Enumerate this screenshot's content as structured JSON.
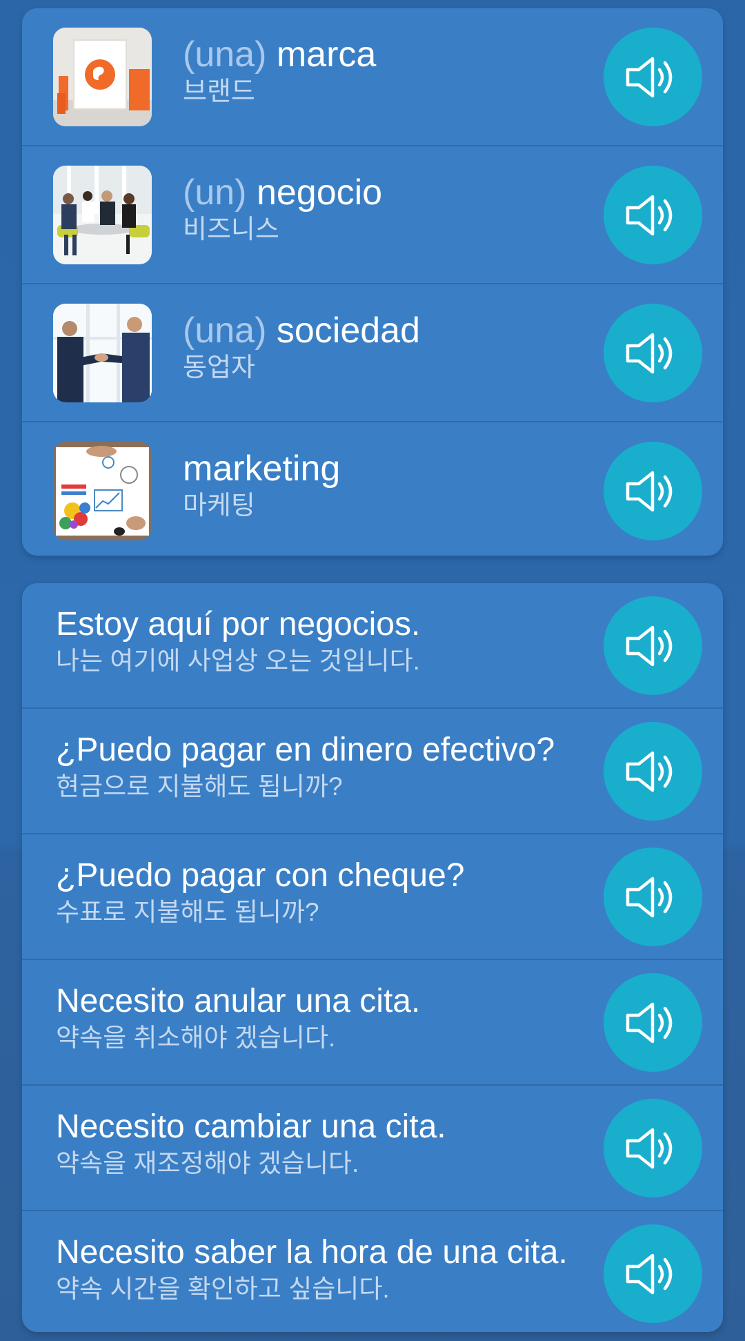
{
  "colors": {
    "background": "#2b67a8",
    "card": "#3a7fc6",
    "audio_button": "#1aaecd",
    "article_text": "#a9c8ec",
    "translation_text": "#c4d8f0"
  },
  "vocabulary": [
    {
      "article": "(una)",
      "word": "marca",
      "translation": "브랜드",
      "image": "brand-image"
    },
    {
      "article": "(un)",
      "word": "negocio",
      "translation": "비즈니스",
      "image": "business-meeting-image"
    },
    {
      "article": "(una)",
      "word": "sociedad",
      "translation": "동업자",
      "image": "handshake-image"
    },
    {
      "article": "",
      "word": "marketing",
      "translation": "마케팅",
      "image": "marketing-image"
    }
  ],
  "phrases": [
    {
      "text": "Estoy aquí por negocios.",
      "translation": "나는 여기에 사업상 오는 것입니다."
    },
    {
      "text": "¿Puedo pagar en dinero efectivo?",
      "translation": "현금으로 지불해도 됩니까?"
    },
    {
      "text": "¿Puedo pagar con cheque?",
      "translation": "수표로 지불해도 됩니까?"
    },
    {
      "text": "Necesito anular una cita.",
      "translation": "약속을 취소해야 겠습니다."
    },
    {
      "text": "Necesito cambiar una cita.",
      "translation": "약속을 재조정해야 겠습니다."
    },
    {
      "text": "Necesito saber la hora de una cita.",
      "translation": "약속 시간을 확인하고 싶습니다."
    }
  ],
  "icons": {
    "audio": "speaker-icon"
  }
}
